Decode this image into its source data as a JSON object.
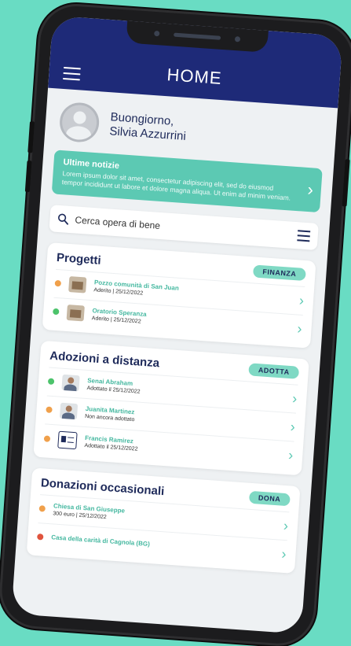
{
  "app": {
    "title": "HOME"
  },
  "greeting": {
    "line1": "Buongiorno,",
    "line2": "Silvia Azzurrini"
  },
  "news": {
    "title": "Ultime notizie",
    "body": "Lorem ipsum dolor sit amet, consectetur adipiscing elit, sed do eiusmod tempor incididunt ut labore et dolore magna aliqua. Ut enim ad minim veniam."
  },
  "search": {
    "placeholder": "Cerca opera di bene"
  },
  "sections": [
    {
      "title": "Progetti",
      "action": "FINANZA",
      "items": [
        {
          "name": "Pozzo comunità di San Juan",
          "sub": "Aderito | 25/12/2022",
          "dot_color": "#f0a04b",
          "thumb": "building"
        },
        {
          "name": "Oratorio Speranza",
          "sub": "Aderito | 25/12/2022",
          "dot_color": "#4cc36b",
          "thumb": "building"
        }
      ]
    },
    {
      "title": "Adozioni a distanza",
      "action": "ADOTTA",
      "items": [
        {
          "name": "Senai Abraham",
          "sub": "Adottato il 25/12/2022",
          "dot_color": "#4cc36b",
          "thumb": "person"
        },
        {
          "name": "Juanita Martinez",
          "sub": "Non ancora adottato",
          "dot_color": "#f0a04b",
          "thumb": "person"
        },
        {
          "name": "Francis Ramirez",
          "sub": "Adottato il 25/12/2022",
          "dot_color": "#f0a04b",
          "thumb": "idcard"
        }
      ]
    },
    {
      "title": "Donazioni occasionali",
      "action": "DONA",
      "items": [
        {
          "name": "Chiesa di San Giuseppe",
          "sub": "300 euro | 25/12/2022",
          "dot_color": "#f0a04b",
          "thumb": ""
        },
        {
          "name": "Casa della carità di Cagnola (BG)",
          "sub": "",
          "dot_color": "#e0533d",
          "thumb": ""
        }
      ]
    }
  ],
  "colors": {
    "header": "#1e2a78",
    "accent": "#5cc9b3",
    "background": "#69dcc3"
  },
  "icons": {
    "menu": "hamburger-menu-icon",
    "search": "search-icon",
    "filter": "filter-icon",
    "chevron": "chevron-right-icon"
  }
}
